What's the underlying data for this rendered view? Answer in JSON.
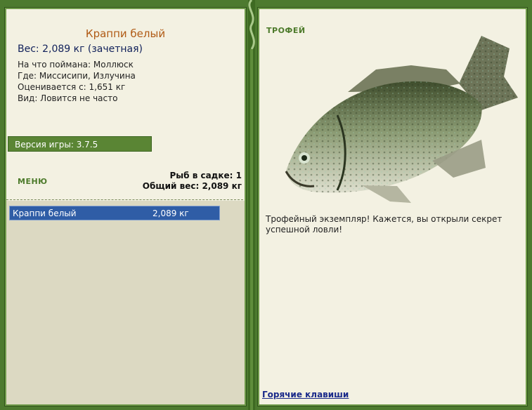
{
  "fish": {
    "name": "Краппи белый",
    "weight_line": "Вес: 2,089 кг (зачетная)",
    "caught_on": "На что поймана: Моллюск",
    "where": "Где: Миссисипи, Излучина",
    "valued_from": "Оценивается с: 1,651 кг",
    "kind": "Вид: Ловится не часто"
  },
  "version": "Версия игры: 3.7.5",
  "menu_label": "МЕНЮ",
  "keepnet": {
    "count_line": "Рыб в садке: 1",
    "total_line": "Общий вес: 2,089 кг"
  },
  "catch_list": [
    {
      "name": "Краппи белый",
      "weight": "2,089 кг"
    }
  ],
  "trophy": {
    "label": "ТРОФЕЙ",
    "text": "Трофейный экземпляр! Кажется, вы открыли секрет успешной ловли!"
  },
  "hotkeys_label": "Горячие клавиши",
  "colors": {
    "frame_green": "#4d7a2f",
    "panel_bg": "#f3f1e2",
    "title_orange": "#b05a14",
    "selection_blue": "#2f5da6"
  }
}
